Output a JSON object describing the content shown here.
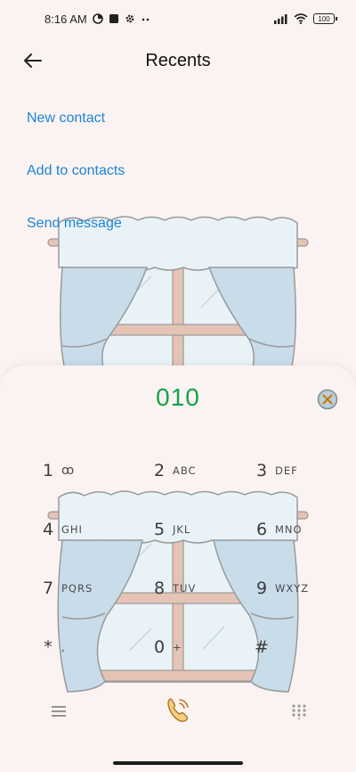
{
  "status_bar": {
    "time": "8:16 AM",
    "battery": "100",
    "icons": [
      "data-saver-icon",
      "square-icon",
      "gear-icon",
      "more-dots-icon",
      "signal-icon",
      "wifi-icon",
      "battery-icon"
    ]
  },
  "header": {
    "title": "Recents",
    "back_icon": "back-arrow-icon"
  },
  "menu": {
    "new_contact": "New contact",
    "add_to_contacts": "Add to contacts",
    "send_message": "Send message"
  },
  "dialer": {
    "number": "010",
    "clear_icon": "clear-x-icon",
    "keys": [
      {
        "digit": "1",
        "letters": "ꝏ"
      },
      {
        "digit": "2",
        "letters": "ABC"
      },
      {
        "digit": "3",
        "letters": "DEF"
      },
      {
        "digit": "4",
        "letters": "GHI"
      },
      {
        "digit": "5",
        "letters": "JKL"
      },
      {
        "digit": "6",
        "letters": "MNO"
      },
      {
        "digit": "7",
        "letters": "PQRS"
      },
      {
        "digit": "8",
        "letters": "TUV"
      },
      {
        "digit": "9",
        "letters": "WXYZ"
      },
      {
        "digit": "*",
        "letters": ","
      },
      {
        "digit": "0",
        "letters": "+"
      },
      {
        "digit": "#",
        "letters": ""
      }
    ]
  },
  "bottom_bar": {
    "menu_icon": "hamburger-menu-icon",
    "call_icon": "phone-call-icon",
    "keypad_icon": "keypad-grid-icon"
  },
  "colors": {
    "accent_link": "#1b86d6",
    "dialed_number": "#16a34a",
    "background": "#fbf3f1",
    "call_button": "#e8a93a"
  }
}
